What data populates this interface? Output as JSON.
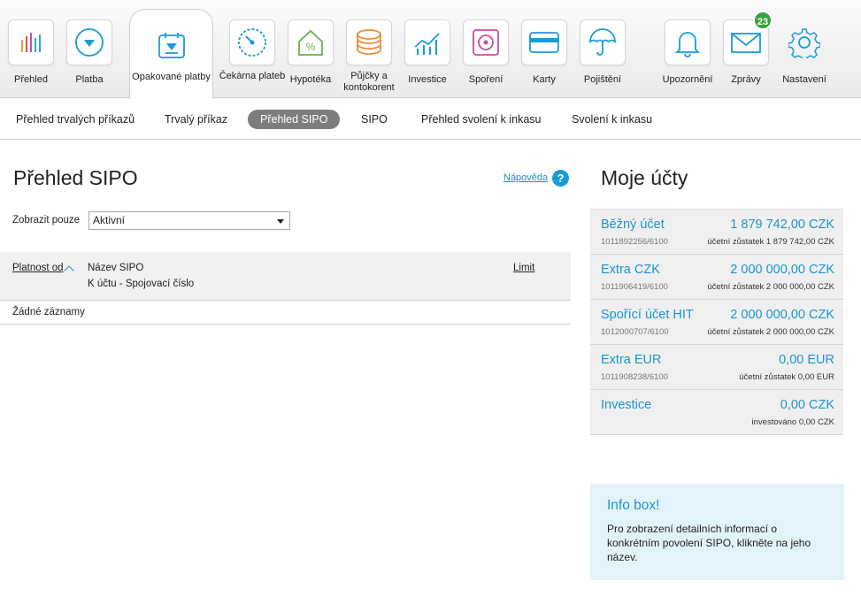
{
  "nav": {
    "items": [
      {
        "label": "Přehled",
        "icon": "bar-chart-icon"
      },
      {
        "label": "Platba",
        "icon": "payment-icon"
      },
      {
        "label": "Opakované platby",
        "icon": "calendar-icon"
      },
      {
        "label": "Čekárna plateb",
        "icon": "gauge-icon"
      },
      {
        "label": "Hypotéka",
        "icon": "house-percent-icon"
      },
      {
        "label": "Půjčky a kontokorent",
        "icon": "coins-icon"
      },
      {
        "label": "Investice",
        "icon": "growth-chart-icon"
      },
      {
        "label": "Spoření",
        "icon": "safe-icon"
      },
      {
        "label": "Karty",
        "icon": "card-icon"
      },
      {
        "label": "Pojištění",
        "icon": "umbrella-icon"
      },
      {
        "label": "Upozornění",
        "icon": "bell-icon"
      },
      {
        "label": "Zprávy",
        "icon": "envelope-icon",
        "badge": "23"
      },
      {
        "label": "Nastavení",
        "icon": "gear-icon"
      }
    ],
    "active_index": 2
  },
  "subnav": {
    "items": [
      "Přehled trvalých příkazů",
      "Trvalý příkaz",
      "Přehled SIPO",
      "SIPO",
      "Přehled svolení k inkasu",
      "Svolení k inkasu"
    ],
    "active_index": 2
  },
  "main": {
    "title": "Přehled SIPO",
    "help_label": "Nápověda",
    "help_icon": "?",
    "filter_label": "Zobrazit pouze",
    "filter_value": "Aktivní",
    "table": {
      "col_valid_from": "Platnost od",
      "col_name": "Název SIPO",
      "col_account": "K účtu - Spojovací číslo",
      "col_limit": "Limit",
      "empty_text": "Žádné záznamy"
    }
  },
  "sidebar": {
    "title": "Moje účty",
    "accounts": [
      {
        "name": "Běžný účet",
        "number": "1011892256/6100",
        "amount": "1 879 742,00 CZK",
        "sub": "účetní zůstatek 1 879 742,00 CZK"
      },
      {
        "name": "Extra CZK",
        "number": "1011906419/6100",
        "amount": "2 000 000,00 CZK",
        "sub": "účetní zůstatek 2 000 000,00 CZK"
      },
      {
        "name": "Spořící účet HIT",
        "number": "1012000707/6100",
        "amount": "2 000 000,00 CZK",
        "sub": "účetní zůstatek 2 000 000,00 CZK"
      },
      {
        "name": "Extra EUR",
        "number": "1011908238/6100",
        "amount": "0,00 EUR",
        "sub": "účetní zůstatek 0,00 EUR"
      },
      {
        "name": "Investice",
        "number": "",
        "amount": "0,00 CZK",
        "sub": "investováno 0,00 CZK"
      }
    ],
    "infobox": {
      "title": "Info box!",
      "text": "Pro zobrazení detailních informací o konkrétním povolení SIPO, klikněte na jeho název."
    }
  },
  "colors": {
    "accent": "#1a95d2",
    "active_pill": "#7d7d7d",
    "badge": "#3aa23a",
    "info_bg": "#e3f3fa"
  }
}
